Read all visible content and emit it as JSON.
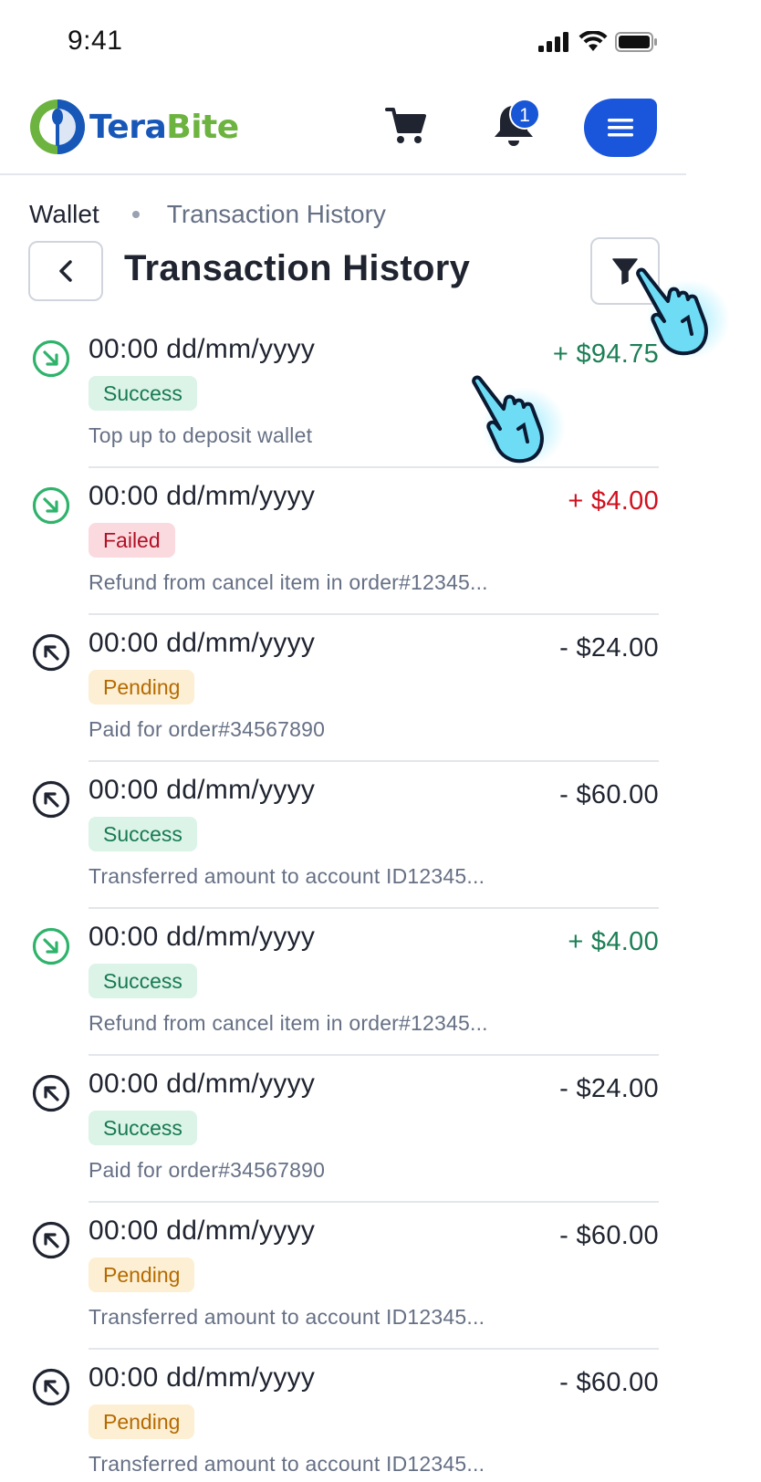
{
  "status_bar": {
    "time": "9:41"
  },
  "brand": {
    "name_part1": "Tera",
    "name_part2": "Bite"
  },
  "header": {
    "notification_count": "1"
  },
  "breadcrumb": {
    "root": "Wallet",
    "current": "Transaction History"
  },
  "page": {
    "title": "Transaction History"
  },
  "transactions": [
    {
      "time": "00:00 dd/mm/yyyy",
      "status": "Success",
      "amount": "+ $94.75",
      "description": "Top up to deposit wallet",
      "direction": "in"
    },
    {
      "time": "00:00 dd/mm/yyyy",
      "status": "Failed",
      "amount": "+ $4.00",
      "description": "Refund from cancel item in order#12345...",
      "direction": "in"
    },
    {
      "time": "00:00 dd/mm/yyyy",
      "status": "Pending",
      "amount": "- $24.00",
      "description": "Paid for order#34567890",
      "direction": "out"
    },
    {
      "time": "00:00 dd/mm/yyyy",
      "status": "Success",
      "amount": "- $60.00",
      "description": "Transferred amount to account ID12345...",
      "direction": "out"
    },
    {
      "time": "00:00 dd/mm/yyyy",
      "status": "Success",
      "amount": "+ $4.00",
      "description": "Refund from cancel item in order#12345...",
      "direction": "in"
    },
    {
      "time": "00:00 dd/mm/yyyy",
      "status": "Success",
      "amount": "- $24.00",
      "description": "Paid for order#34567890",
      "direction": "out"
    },
    {
      "time": "00:00 dd/mm/yyyy",
      "status": "Pending",
      "amount": "- $60.00",
      "description": "Transferred amount to account ID12345...",
      "direction": "out"
    },
    {
      "time": "00:00 dd/mm/yyyy",
      "status": "Pending",
      "amount": "- $60.00",
      "description": "Transferred amount to account ID12345...",
      "direction": "out"
    }
  ],
  "icons": {
    "incoming": "arrow-down-right-circle-icon",
    "outgoing": "arrow-up-left-circle-icon",
    "cart": "cart-icon",
    "bell": "bell-icon",
    "menu": "hamburger-menu-icon",
    "back": "chevron-left-icon",
    "filter": "filter-icon",
    "cursor": "hand-pointer-icon"
  },
  "colors": {
    "brand_blue": "#1757b8",
    "brand_green": "#6cb33f",
    "accent": "#1a56db",
    "positive": "#1c7f56",
    "negative": "#d1101e",
    "incoming_icon": "#2fb36b",
    "outgoing_icon": "#1f2430"
  }
}
